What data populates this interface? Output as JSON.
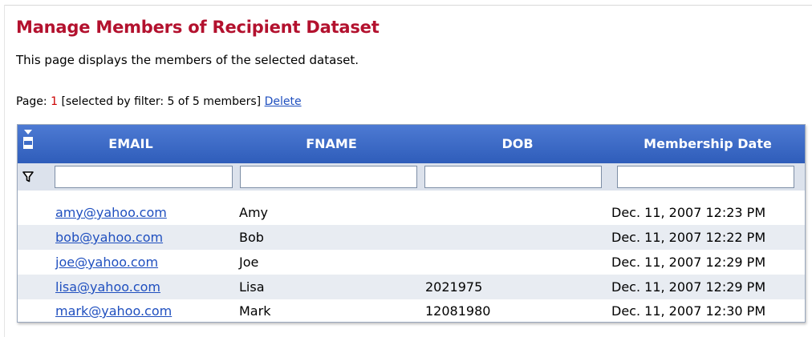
{
  "page": {
    "title": "Manage Members of Recipient Dataset",
    "description": "This page displays the members of the selected dataset."
  },
  "pager": {
    "label": "Page:",
    "current_page": "1",
    "filter_info": "[selected by filter: 5 of 5 members]",
    "delete_link": "Delete"
  },
  "grid": {
    "icons": {
      "save": "save-icon",
      "filter": "filter-funnel-icon"
    },
    "colors": {
      "header": "#3a67c4",
      "title": "#b3112e",
      "link": "#1f4fbf",
      "alt_row": "#e8ecf2"
    },
    "columns": [
      "EMAIL",
      "FNAME",
      "DOB",
      "Membership Date"
    ],
    "filters": [
      "",
      "",
      "",
      ""
    ],
    "rows": [
      {
        "email": "amy@yahoo.com",
        "fname": "Amy",
        "dob": "",
        "membership_date": "Dec. 11, 2007 12:23 PM"
      },
      {
        "email": "bob@yahoo.com",
        "fname": "Bob",
        "dob": "",
        "membership_date": "Dec. 11, 2007 12:22 PM"
      },
      {
        "email": "joe@yahoo.com",
        "fname": "Joe",
        "dob": "",
        "membership_date": "Dec. 11, 2007 12:29 PM"
      },
      {
        "email": "lisa@yahoo.com",
        "fname": "Lisa",
        "dob": "2021975",
        "membership_date": "Dec. 11, 2007 12:29 PM"
      },
      {
        "email": "mark@yahoo.com",
        "fname": "Mark",
        "dob": "12081980",
        "membership_date": "Dec. 11, 2007 12:30 PM"
      }
    ]
  }
}
